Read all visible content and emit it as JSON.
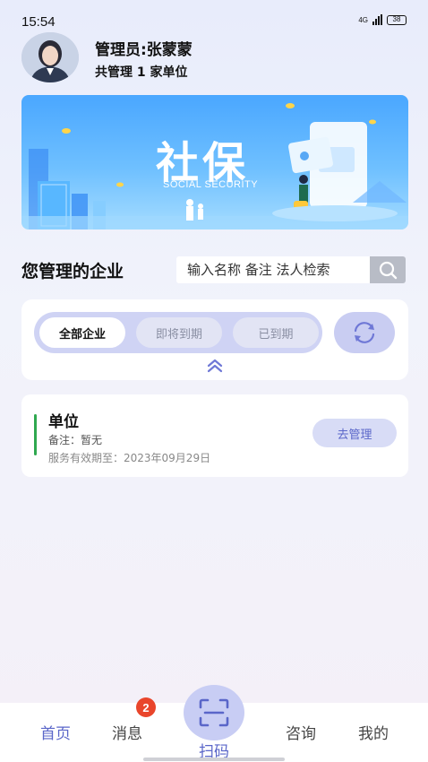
{
  "status_bar": {
    "time": "15:54",
    "network": "4G",
    "battery": "38"
  },
  "profile": {
    "admin_name": "管理员:张蒙蒙",
    "manage_count": "共管理 1 家单位"
  },
  "banner": {
    "title": "社保",
    "subtitle": "SOCIAL SECURITY"
  },
  "section": {
    "title": "您管理的企业"
  },
  "search": {
    "placeholder": "输入名称 备注 法人检索"
  },
  "filter_tabs": [
    {
      "label": "全部企业",
      "active": true
    },
    {
      "label": "即将到期",
      "active": false
    },
    {
      "label": "已到期",
      "active": false
    }
  ],
  "companies": [
    {
      "name": "单位",
      "note": "备注：暂无",
      "expiry": "服务有效期至：2023年09月29日",
      "action_label": "去管理"
    }
  ],
  "bottom_nav": {
    "home": "首页",
    "messages": "消息",
    "messages_badge": "2",
    "scan": "扫码",
    "consult": "咨询",
    "mine": "我的"
  },
  "colors": {
    "accent": "#5a66c9",
    "accent_light": "#c9cdf2",
    "badge": "#e9452b",
    "company_bar": "#2fa84f"
  },
  "icons": [
    "search-icon",
    "refresh-icon",
    "double-chevron-up-icon",
    "scan-icon",
    "avatar"
  ]
}
